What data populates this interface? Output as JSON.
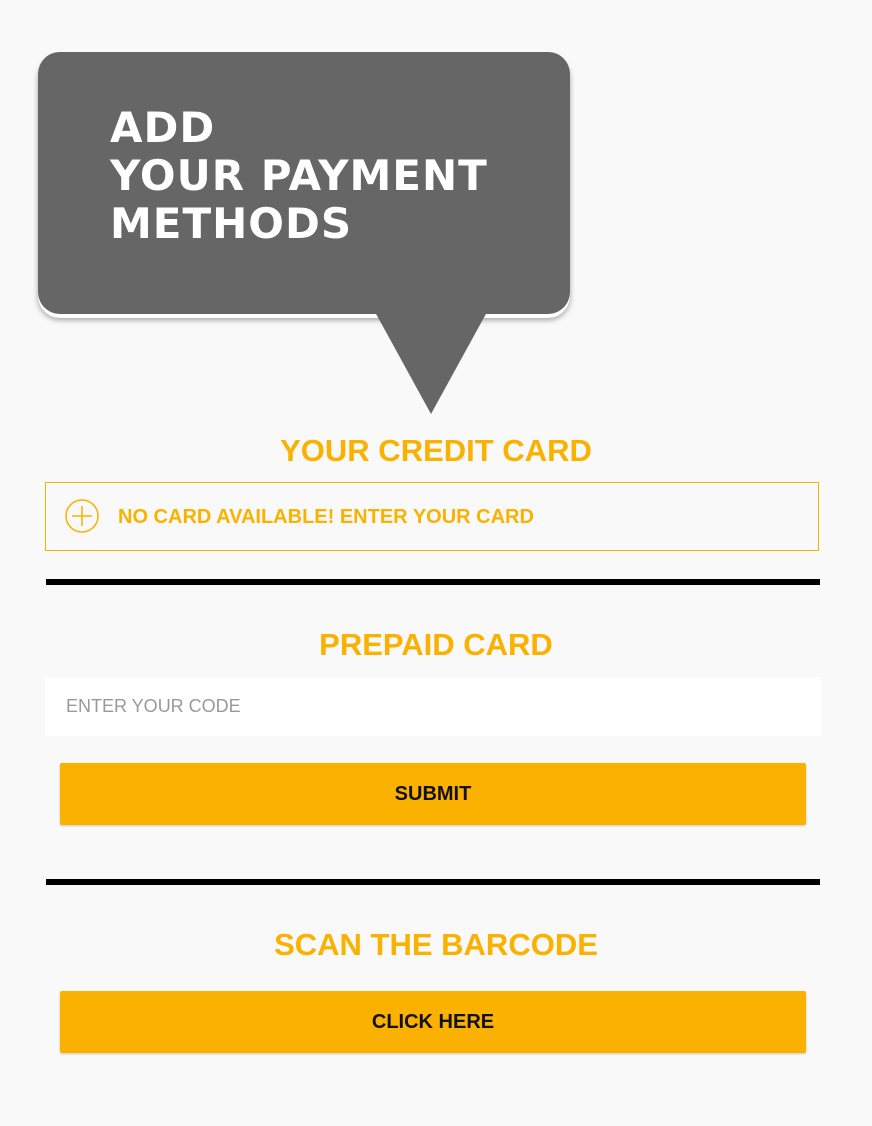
{
  "header": {
    "title_lines": [
      "ADD",
      "YOUR PAYMENT",
      "METHODS"
    ]
  },
  "credit_card": {
    "title": "YOUR CREDIT CARD",
    "empty_label": "NO CARD AVAILABLE! ENTER YOUR CARD",
    "add_icon": "plus-circle-icon"
  },
  "prepaid": {
    "title": "PREPAID CARD",
    "code_value": "",
    "code_placeholder": "ENTER YOUR CODE",
    "submit_label": "SUBMIT"
  },
  "barcode": {
    "title": "SCAN THE BARCODE",
    "button_label": "CLICK HERE"
  },
  "colors": {
    "accent": "#fbb100",
    "bubble": "#666666",
    "divider": "#000000",
    "background": "#f9f9f9"
  }
}
